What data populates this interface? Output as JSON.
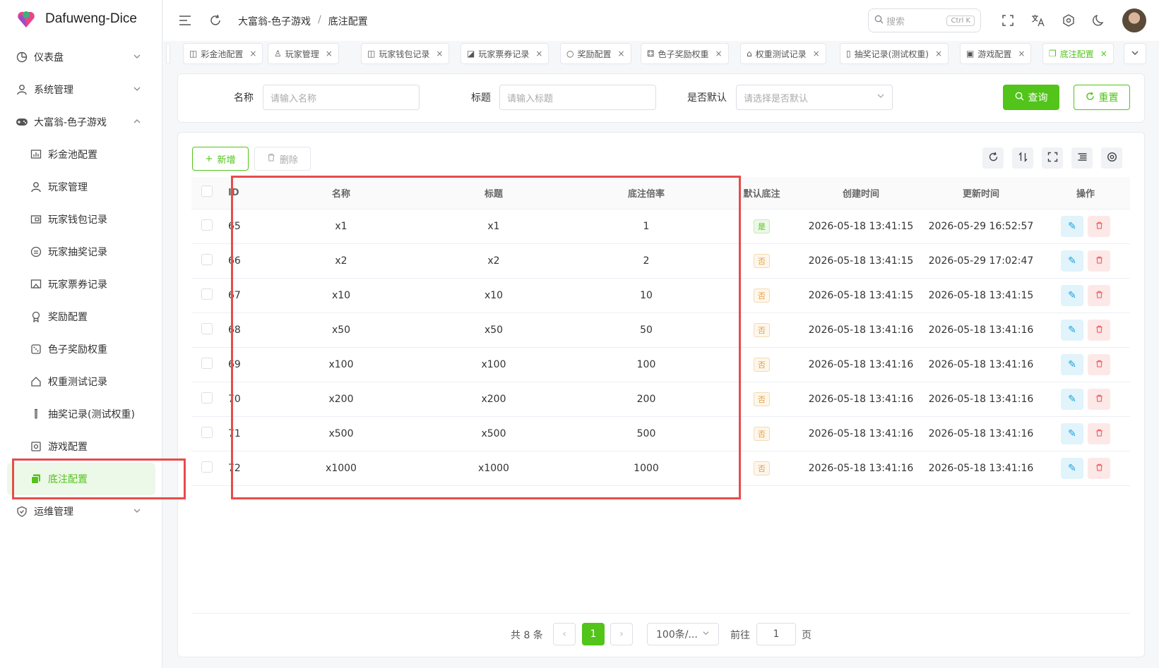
{
  "app": {
    "name": "Dafuweng-Dice"
  },
  "sidebar": {
    "items": [
      {
        "label": "仪表盘",
        "icon": "dashboard-icon"
      },
      {
        "label": "系统管理",
        "icon": "user-icon"
      },
      {
        "label": "大富翁-色子游戏",
        "icon": "gamepad-icon"
      },
      {
        "label": "彩金池配置",
        "icon": "chart-icon"
      },
      {
        "label": "玩家管理",
        "icon": "user-icon"
      },
      {
        "label": "玩家钱包记录",
        "icon": "wallet-icon"
      },
      {
        "label": "玩家抽奖记录",
        "icon": "record-icon"
      },
      {
        "label": "玩家票券记录",
        "icon": "ticket-icon"
      },
      {
        "label": "奖励配置",
        "icon": "award-icon"
      },
      {
        "label": "色子奖励权重",
        "icon": "dice-icon"
      },
      {
        "label": "权重测试记录",
        "icon": "home-icon"
      },
      {
        "label": "抽奖记录(测试权重)",
        "icon": "tube-icon"
      },
      {
        "label": "游戏配置",
        "icon": "settings-icon"
      },
      {
        "label": "底注配置",
        "icon": "copy-icon"
      },
      {
        "label": "运维管理",
        "icon": "shield-icon"
      }
    ]
  },
  "header": {
    "breadcrumb": [
      "大富翁-色子游戏",
      "/",
      "底注配置"
    ],
    "search_placeholder": "搜索",
    "shortcut": "Ctrl K"
  },
  "tabs": [
    "彩金池配置",
    "玩家管理",
    "玩家钱包记录",
    "玩家票券记录",
    "奖励配置",
    "色子奖励权重",
    "权重测试记录",
    "抽奖记录(测试权重)",
    "游戏配置",
    "底注配置"
  ],
  "filters": {
    "name_label": "名称",
    "name_placeholder": "请输入名称",
    "title_label": "标题",
    "title_placeholder": "请输入标题",
    "default_label": "是否默认",
    "default_placeholder": "请选择是否默认",
    "query": "查询",
    "reset": "重置"
  },
  "toolbar": {
    "add": "新增",
    "delete": "删除"
  },
  "table": {
    "columns": [
      "ID",
      "名称",
      "标题",
      "底注倍率",
      "默认底注",
      "创建时间",
      "更新时间",
      "操作"
    ],
    "rows": [
      {
        "id": "65",
        "name": "x1",
        "title": "x1",
        "rate": "1",
        "default": "是",
        "created": "2026-05-18 13:41:15",
        "updated": "2026-05-29 16:52:57"
      },
      {
        "id": "66",
        "name": "x2",
        "title": "x2",
        "rate": "2",
        "default": "否",
        "created": "2026-05-18 13:41:15",
        "updated": "2026-05-29 17:02:47"
      },
      {
        "id": "67",
        "name": "x10",
        "title": "x10",
        "rate": "10",
        "default": "否",
        "created": "2026-05-18 13:41:15",
        "updated": "2026-05-18 13:41:15"
      },
      {
        "id": "68",
        "name": "x50",
        "title": "x50",
        "rate": "50",
        "default": "否",
        "created": "2026-05-18 13:41:16",
        "updated": "2026-05-18 13:41:16"
      },
      {
        "id": "69",
        "name": "x100",
        "title": "x100",
        "rate": "100",
        "default": "否",
        "created": "2026-05-18 13:41:16",
        "updated": "2026-05-18 13:41:16"
      },
      {
        "id": "70",
        "name": "x200",
        "title": "x200",
        "rate": "200",
        "default": "否",
        "created": "2026-05-18 13:41:16",
        "updated": "2026-05-18 13:41:16"
      },
      {
        "id": "71",
        "name": "x500",
        "title": "x500",
        "rate": "500",
        "default": "否",
        "created": "2026-05-18 13:41:16",
        "updated": "2026-05-18 13:41:16"
      },
      {
        "id": "72",
        "name": "x1000",
        "title": "x1000",
        "rate": "1000",
        "default": "否",
        "created": "2026-05-18 13:41:16",
        "updated": "2026-05-18 13:41:16"
      }
    ]
  },
  "pagination": {
    "total": "共 8 条",
    "current": "1",
    "page_size": "100条/...",
    "goto_label": "前往",
    "goto_value": "1",
    "page_suffix": "页"
  },
  "colors": {
    "accent": "#52c41a",
    "highlight_box": "#e74c4c"
  }
}
